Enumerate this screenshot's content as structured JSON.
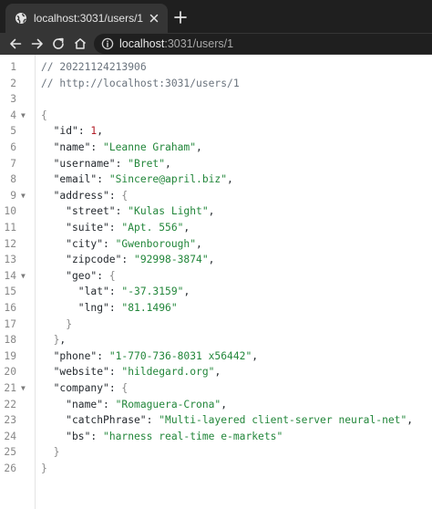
{
  "browser": {
    "tab_title": "localhost:3031/users/1",
    "url_host": "localhost",
    "url_rest": ":3031/users/1"
  },
  "editor": {
    "lines": [
      {
        "n": "1",
        "fold": false,
        "indent": 0,
        "tokens": [
          {
            "t": "// 20221124213906",
            "c": "comment"
          }
        ]
      },
      {
        "n": "2",
        "fold": false,
        "indent": 0,
        "tokens": [
          {
            "t": "// http://localhost:3031/users/1",
            "c": "comment"
          }
        ]
      },
      {
        "n": "3",
        "fold": false,
        "indent": 0,
        "tokens": []
      },
      {
        "n": "4",
        "fold": true,
        "indent": 0,
        "tokens": [
          {
            "t": "{",
            "c": "brace"
          }
        ]
      },
      {
        "n": "5",
        "fold": false,
        "indent": 1,
        "tokens": [
          {
            "t": "\"id\"",
            "c": "key"
          },
          {
            "t": ": ",
            "c": "punct"
          },
          {
            "t": "1",
            "c": "num"
          },
          {
            "t": ",",
            "c": "punct"
          }
        ]
      },
      {
        "n": "6",
        "fold": false,
        "indent": 1,
        "tokens": [
          {
            "t": "\"name\"",
            "c": "key"
          },
          {
            "t": ": ",
            "c": "punct"
          },
          {
            "t": "\"Leanne Graham\"",
            "c": "str"
          },
          {
            "t": ",",
            "c": "punct"
          }
        ]
      },
      {
        "n": "7",
        "fold": false,
        "indent": 1,
        "tokens": [
          {
            "t": "\"username\"",
            "c": "key"
          },
          {
            "t": ": ",
            "c": "punct"
          },
          {
            "t": "\"Bret\"",
            "c": "str"
          },
          {
            "t": ",",
            "c": "punct"
          }
        ]
      },
      {
        "n": "8",
        "fold": false,
        "indent": 1,
        "tokens": [
          {
            "t": "\"email\"",
            "c": "key"
          },
          {
            "t": ": ",
            "c": "punct"
          },
          {
            "t": "\"Sincere@april.biz\"",
            "c": "str"
          },
          {
            "t": ",",
            "c": "punct"
          }
        ]
      },
      {
        "n": "9",
        "fold": true,
        "indent": 1,
        "tokens": [
          {
            "t": "\"address\"",
            "c": "key"
          },
          {
            "t": ": ",
            "c": "punct"
          },
          {
            "t": "{",
            "c": "brace"
          }
        ]
      },
      {
        "n": "10",
        "fold": false,
        "indent": 2,
        "tokens": [
          {
            "t": "\"street\"",
            "c": "key"
          },
          {
            "t": ": ",
            "c": "punct"
          },
          {
            "t": "\"Kulas Light\"",
            "c": "str"
          },
          {
            "t": ",",
            "c": "punct"
          }
        ]
      },
      {
        "n": "11",
        "fold": false,
        "indent": 2,
        "tokens": [
          {
            "t": "\"suite\"",
            "c": "key"
          },
          {
            "t": ": ",
            "c": "punct"
          },
          {
            "t": "\"Apt. 556\"",
            "c": "str"
          },
          {
            "t": ",",
            "c": "punct"
          }
        ]
      },
      {
        "n": "12",
        "fold": false,
        "indent": 2,
        "tokens": [
          {
            "t": "\"city\"",
            "c": "key"
          },
          {
            "t": ": ",
            "c": "punct"
          },
          {
            "t": "\"Gwenborough\"",
            "c": "str"
          },
          {
            "t": ",",
            "c": "punct"
          }
        ]
      },
      {
        "n": "13",
        "fold": false,
        "indent": 2,
        "tokens": [
          {
            "t": "\"zipcode\"",
            "c": "key"
          },
          {
            "t": ": ",
            "c": "punct"
          },
          {
            "t": "\"92998-3874\"",
            "c": "str"
          },
          {
            "t": ",",
            "c": "punct"
          }
        ]
      },
      {
        "n": "14",
        "fold": true,
        "indent": 2,
        "tokens": [
          {
            "t": "\"geo\"",
            "c": "key"
          },
          {
            "t": ": ",
            "c": "punct"
          },
          {
            "t": "{",
            "c": "brace"
          }
        ]
      },
      {
        "n": "15",
        "fold": false,
        "indent": 3,
        "tokens": [
          {
            "t": "\"lat\"",
            "c": "key"
          },
          {
            "t": ": ",
            "c": "punct"
          },
          {
            "t": "\"-37.3159\"",
            "c": "str"
          },
          {
            "t": ",",
            "c": "punct"
          }
        ]
      },
      {
        "n": "16",
        "fold": false,
        "indent": 3,
        "tokens": [
          {
            "t": "\"lng\"",
            "c": "key"
          },
          {
            "t": ": ",
            "c": "punct"
          },
          {
            "t": "\"81.1496\"",
            "c": "str"
          }
        ]
      },
      {
        "n": "17",
        "fold": false,
        "indent": 2,
        "tokens": [
          {
            "t": "}",
            "c": "brace"
          }
        ]
      },
      {
        "n": "18",
        "fold": false,
        "indent": 1,
        "tokens": [
          {
            "t": "}",
            "c": "brace"
          },
          {
            "t": ",",
            "c": "punct"
          }
        ]
      },
      {
        "n": "19",
        "fold": false,
        "indent": 1,
        "tokens": [
          {
            "t": "\"phone\"",
            "c": "key"
          },
          {
            "t": ": ",
            "c": "punct"
          },
          {
            "t": "\"1-770-736-8031 x56442\"",
            "c": "str"
          },
          {
            "t": ",",
            "c": "punct"
          }
        ]
      },
      {
        "n": "20",
        "fold": false,
        "indent": 1,
        "tokens": [
          {
            "t": "\"website\"",
            "c": "key"
          },
          {
            "t": ": ",
            "c": "punct"
          },
          {
            "t": "\"hildegard.org\"",
            "c": "str"
          },
          {
            "t": ",",
            "c": "punct"
          }
        ]
      },
      {
        "n": "21",
        "fold": true,
        "indent": 1,
        "tokens": [
          {
            "t": "\"company\"",
            "c": "key"
          },
          {
            "t": ": ",
            "c": "punct"
          },
          {
            "t": "{",
            "c": "brace"
          }
        ]
      },
      {
        "n": "22",
        "fold": false,
        "indent": 2,
        "tokens": [
          {
            "t": "\"name\"",
            "c": "key"
          },
          {
            "t": ": ",
            "c": "punct"
          },
          {
            "t": "\"Romaguera-Crona\"",
            "c": "str"
          },
          {
            "t": ",",
            "c": "punct"
          }
        ]
      },
      {
        "n": "23",
        "fold": false,
        "indent": 2,
        "tokens": [
          {
            "t": "\"catchPhrase\"",
            "c": "key"
          },
          {
            "t": ": ",
            "c": "punct"
          },
          {
            "t": "\"Multi-layered client-server neural-net\"",
            "c": "str"
          },
          {
            "t": ",",
            "c": "punct"
          }
        ]
      },
      {
        "n": "24",
        "fold": false,
        "indent": 2,
        "tokens": [
          {
            "t": "\"bs\"",
            "c": "key"
          },
          {
            "t": ": ",
            "c": "punct"
          },
          {
            "t": "\"harness real-time e-markets\"",
            "c": "str"
          }
        ]
      },
      {
        "n": "25",
        "fold": false,
        "indent": 1,
        "tokens": [
          {
            "t": "}",
            "c": "brace"
          }
        ]
      },
      {
        "n": "26",
        "fold": false,
        "indent": 0,
        "tokens": [
          {
            "t": "}",
            "c": "brace"
          }
        ]
      }
    ]
  }
}
